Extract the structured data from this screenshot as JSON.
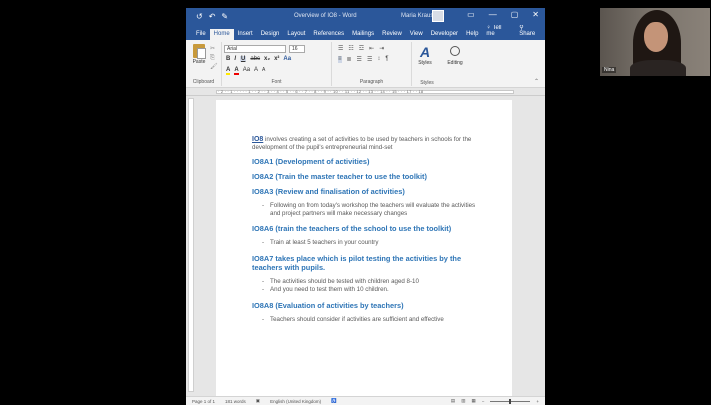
{
  "window": {
    "title": "Overview of IO8 - Word",
    "user": "Maria Kraus",
    "quick_access": [
      "↺",
      "↶",
      "✎"
    ],
    "controls": [
      "▭",
      "—",
      "▢",
      "✕"
    ]
  },
  "ribbon_tabs": [
    "File",
    "Home",
    "Insert",
    "Design",
    "Layout",
    "References",
    "Mailings",
    "Review",
    "View",
    "Developer",
    "Help"
  ],
  "tell_me": "Tell me",
  "share": "Share",
  "ribbon": {
    "paste": "Paste",
    "font_name": "Arial",
    "font_size": "16",
    "format_row1": [
      "B",
      "I",
      "U",
      "abc",
      "x₂",
      "x²",
      "Aa"
    ],
    "format_row2": [
      "A",
      "A",
      "Aa",
      "A",
      "A"
    ],
    "para_row1": [
      "☰",
      "☷",
      "☲",
      "⇤",
      "⇥"
    ],
    "para_row2": [
      "≡",
      "≣",
      "☰",
      "☰",
      "↕",
      "¶"
    ],
    "styles": "Styles",
    "editing": "Editing",
    "groups": {
      "clipboard": "Clipboard",
      "font": "Font",
      "paragraph": "Paragraph",
      "styles": "Styles"
    }
  },
  "ruler_numbers": "· 2 · · 1 · · · · · 1 · · 2 · · 3 · · 4 · · 5 · · 6 · · 7 · · 8 · · 9 · · 10 · · 11 · · 12 · · 13 · · 14 · · 15 · · · 17 · · 18",
  "document": {
    "intro_link": "IO8",
    "intro_text": " involves creating a set of activities to be used by teachers in schools for the development of the pupil's entrepreneurial mind-set",
    "h1": "IO8A1 (Development of activities)",
    "h2": "IO8A2 (Train the master teacher to use the toolkit)",
    "h3": "IO8A3 (Review and finalisation of activities)",
    "b3_1": "Following on from today's workshop the teachers will evaluate the activities and project partners will make necessary changes",
    "h6": "IO8A6 (train the teachers of the school to use the toolkit)",
    "b6_1": "Train at least 5 teachers in your country",
    "h7": "IO8A7 takes place which is pilot testing the activities by the teachers with pupils.",
    "b7_1": "The activities should be tested with children aged 8-10",
    "b7_2": "And you need to test them with 10 children.",
    "h8": "IO8A8 (Evaluation of activities by teachers)",
    "b8_1": "Teachers should consider if activities are sufficient and effective"
  },
  "status": {
    "page": "Page 1 of 1",
    "words": "181 words",
    "language": "English (United Kingdom)",
    "zoom_icons": [
      "▤",
      "▥",
      "▦"
    ]
  },
  "video": {
    "participant_name": "Nina"
  }
}
